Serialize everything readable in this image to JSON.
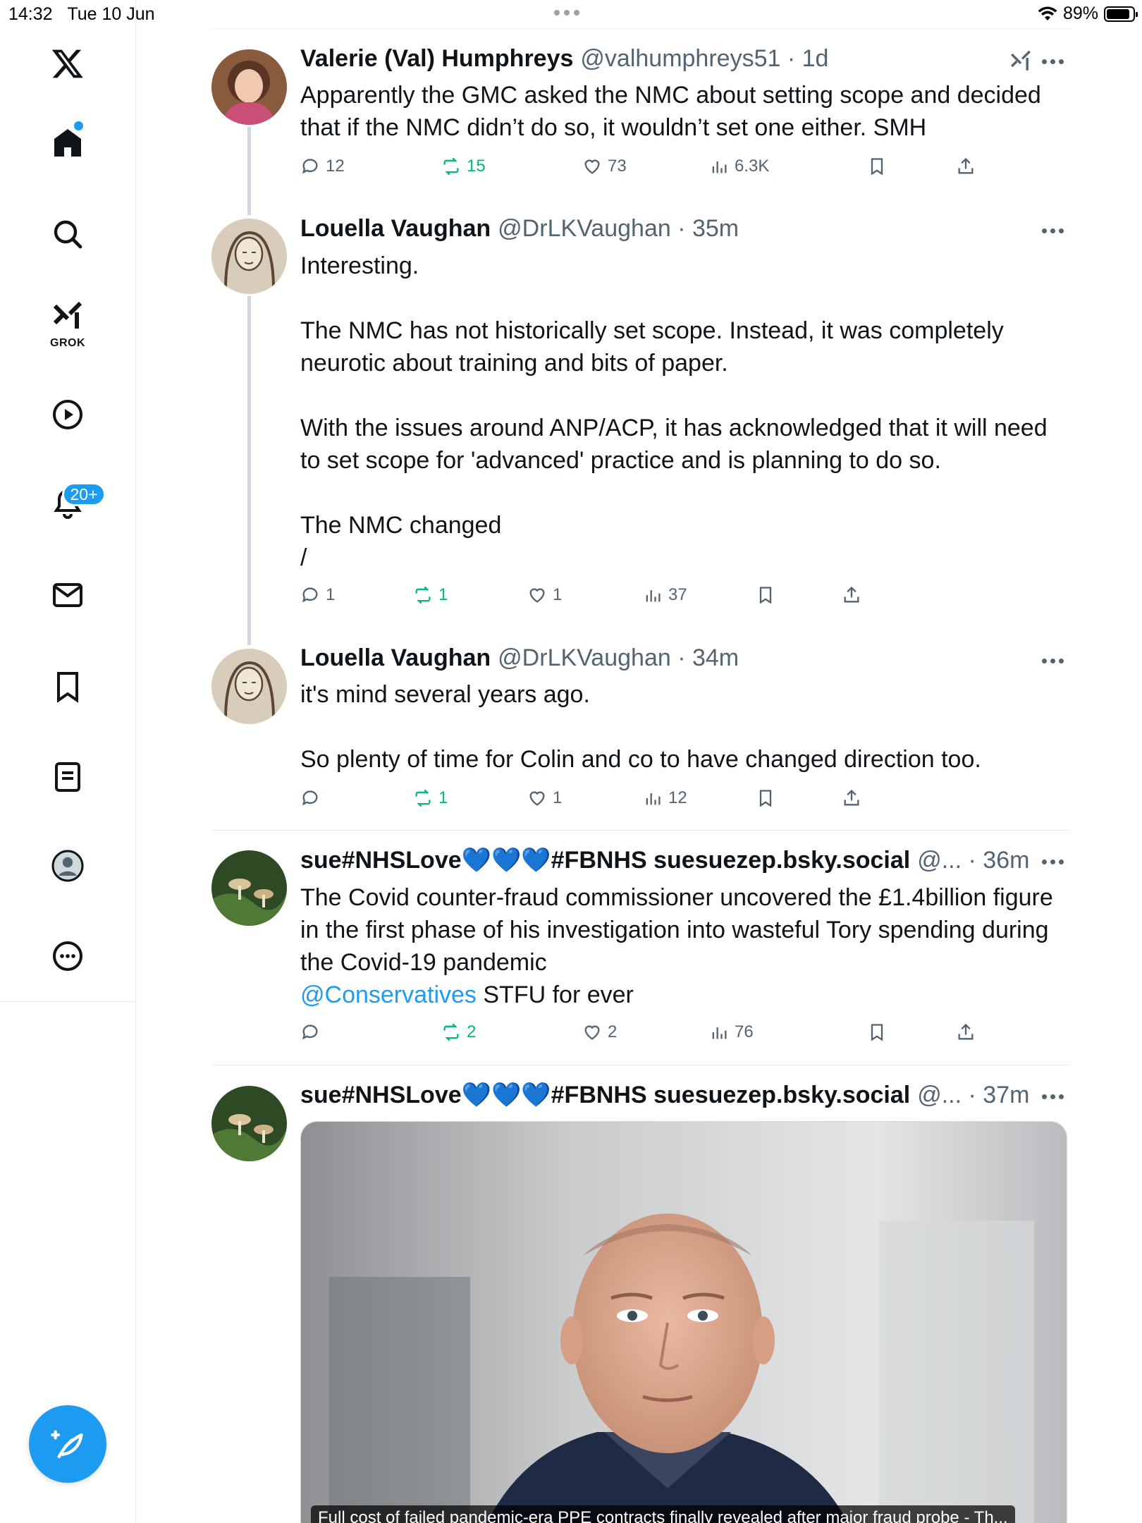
{
  "status_bar": {
    "time": "14:32",
    "date": "Tue 10 Jun",
    "battery": "89%"
  },
  "sidebar": {
    "items": [
      {
        "name": "x-logo-icon"
      },
      {
        "name": "home-icon"
      },
      {
        "name": "search-icon"
      },
      {
        "name": "grok-icon",
        "label": "GROK"
      },
      {
        "name": "video-icon"
      },
      {
        "name": "notifications-icon",
        "badge": "20+"
      },
      {
        "name": "messages-icon"
      },
      {
        "name": "bookmarks-icon"
      },
      {
        "name": "lists-icon"
      },
      {
        "name": "profile-icon"
      },
      {
        "name": "more-icon"
      }
    ],
    "compose": "compose-icon"
  },
  "colors": {
    "accent": "#1d9bf0",
    "repost_active": "#00ba7c",
    "muted": "#536471"
  },
  "tweets": [
    {
      "name": "Valerie (Val) Humphreys",
      "handle": "@valhumphreys51",
      "time": "1d",
      "text": "Apparently the GMC asked the NMC about setting scope and decided that if the NMC didn’t do so, it wouldn’t set one either. SMH",
      "replies": "12",
      "reposts": "15",
      "likes": "73",
      "views": "6.3K"
    },
    {
      "name": "Louella Vaughan",
      "handle": "@DrLKVaughan",
      "time": "35m",
      "text": "Interesting.\n\nThe NMC has not historically set scope. Instead, it was completely neurotic about training and bits of paper.\n\nWith the issues around ANP/ACP, it has acknowledged that it will need to set scope for 'advanced' practice and is planning to do so.\n\nThe NMC changed\n/",
      "replies": "1",
      "reposts": "1",
      "likes": "1",
      "views": "37"
    },
    {
      "name": "Louella Vaughan",
      "handle": "@DrLKVaughan",
      "time": "34m",
      "text": "it's mind several years ago.\n\nSo plenty of time for Colin and co to have changed direction too.",
      "replies": "",
      "reposts": "1",
      "likes": "1",
      "views": "12"
    },
    {
      "name": "sue#NHSLove💙💙💙#FBNHS suesuezep.bsky.social",
      "handle": "@...",
      "time": "36m",
      "text": "The Covid counter-fraud commissioner uncovered the £1.4billion figure in the first phase of his investigation into wasteful Tory spending during the Covid-19 pandemic\n",
      "mention": "@Conservatives",
      "text_after": " STFU for ever",
      "replies": "",
      "reposts": "2",
      "likes": "2",
      "views": "76"
    },
    {
      "name": "sue#NHSLove💙💙💙#FBNHS suesuezep.bsky.social",
      "handle": "@...",
      "time": "37m",
      "media_caption": "Full cost of failed pandemic-era PPE contracts finally revealed after major fraud probe - Th..."
    }
  ]
}
